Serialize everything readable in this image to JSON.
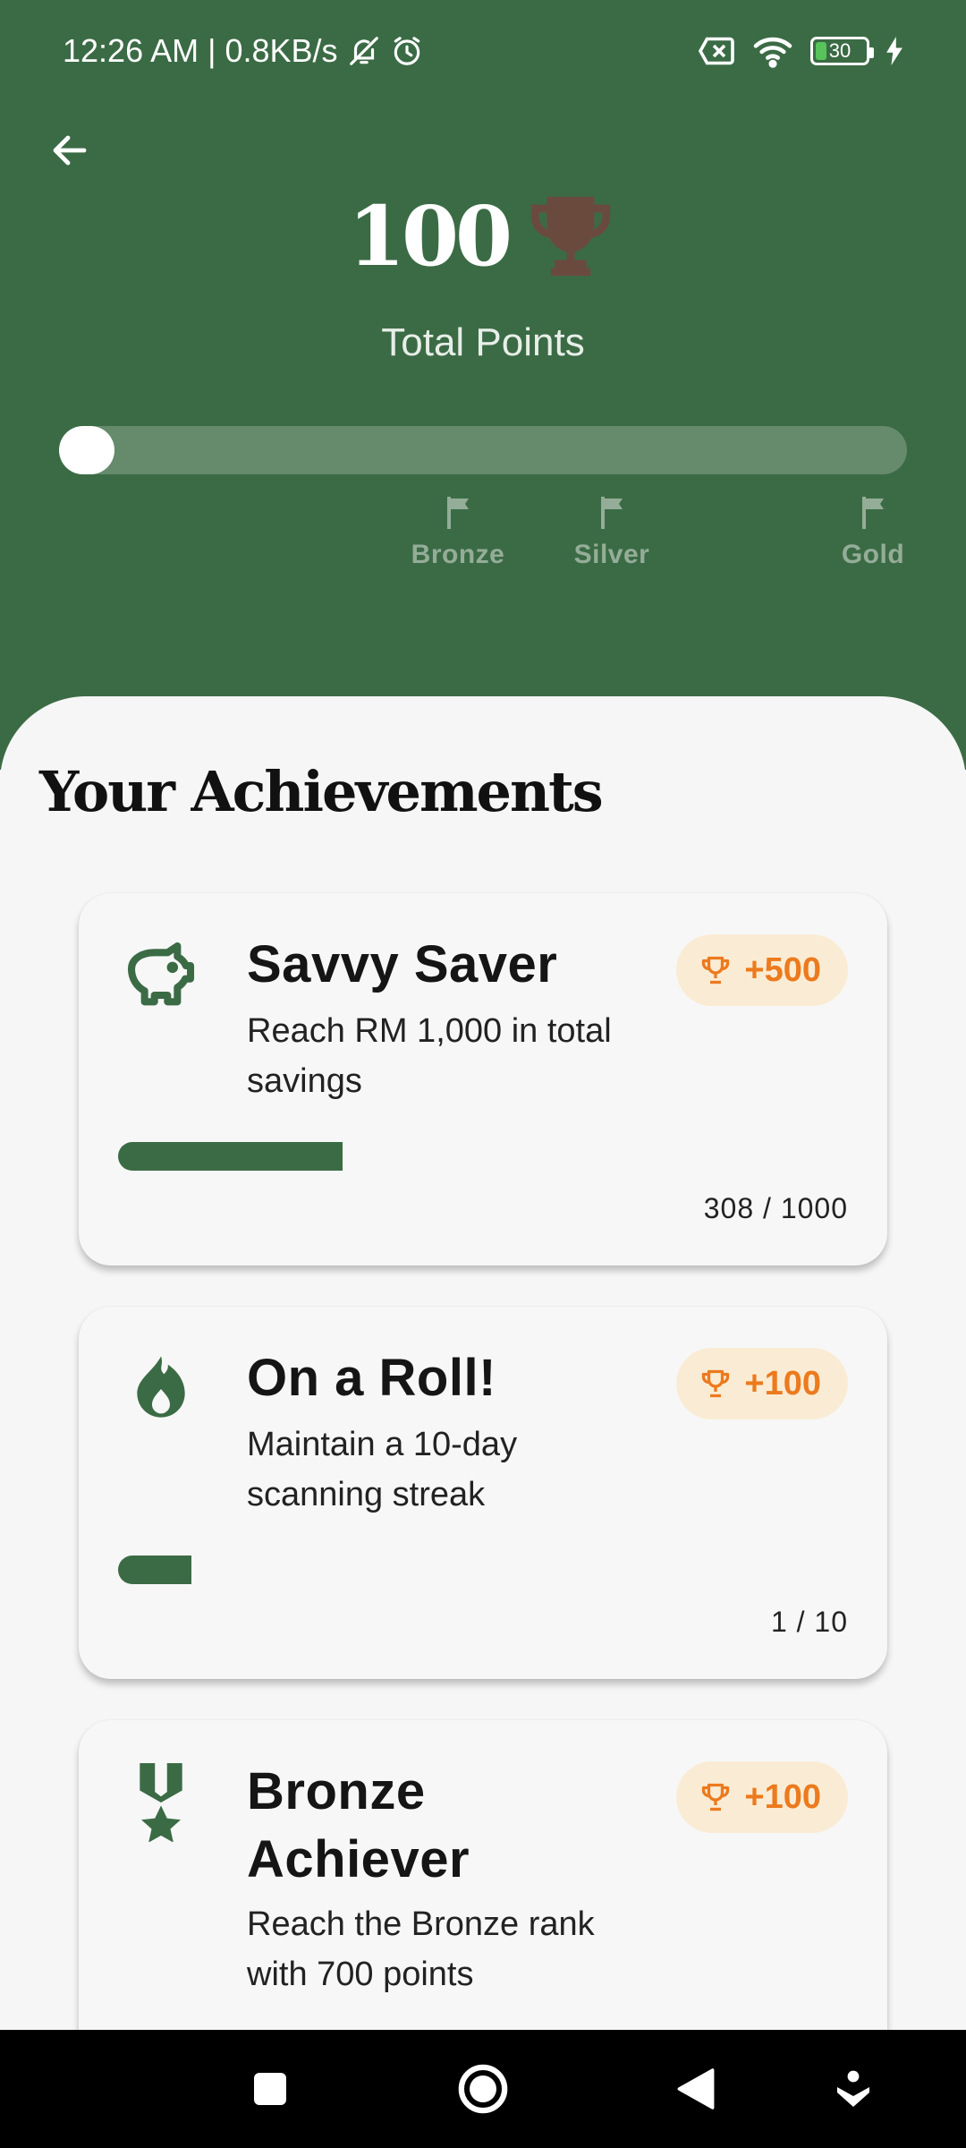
{
  "status_bar": {
    "time_speed": "12:26 AM | 0.8KB/s",
    "battery_level": "30",
    "icons": [
      "bell-off-icon",
      "alarm-icon",
      "sim-x-icon",
      "wifi-icon",
      "battery-icon",
      "charging-icon"
    ]
  },
  "header": {
    "back_icon": "arrow-left-icon",
    "points": "100",
    "trophy_icon": "trophy-icon",
    "points_label": "Total Points",
    "progress_fraction": 0.0,
    "milestones": [
      {
        "label": "Bronze",
        "icon": "flag-icon"
      },
      {
        "label": "Silver",
        "icon": "flag-icon"
      },
      {
        "label": "Gold",
        "icon": "flag-icon"
      }
    ]
  },
  "achievements": {
    "title": "Your Achievements",
    "items": [
      {
        "icon": "piggy-bank-icon",
        "title": "Savvy Saver",
        "description": "Reach RM 1,000 in total savings",
        "reward": "+500",
        "progress_text": "308 / 1000",
        "progress_fraction": 0.308
      },
      {
        "icon": "fire-icon",
        "title": "On a Roll!",
        "description": "Maintain a 10-day scanning streak",
        "reward": "+100",
        "progress_text": "1 / 10",
        "progress_fraction": 0.1
      },
      {
        "icon": "medal-icon",
        "title": "Bronze Achiever",
        "description": "Reach the Bronze rank with 700 points",
        "reward": "+100"
      }
    ]
  },
  "colors": {
    "header_green": "#3b6b45",
    "trophy_brown": "#6b4a3e",
    "badge_bg": "#faecd4",
    "badge_text": "#ec7a1e"
  },
  "nav_bar": {
    "icons": [
      "recents-square-icon",
      "home-circle-icon",
      "back-triangle-icon",
      "assistant-icon"
    ]
  }
}
